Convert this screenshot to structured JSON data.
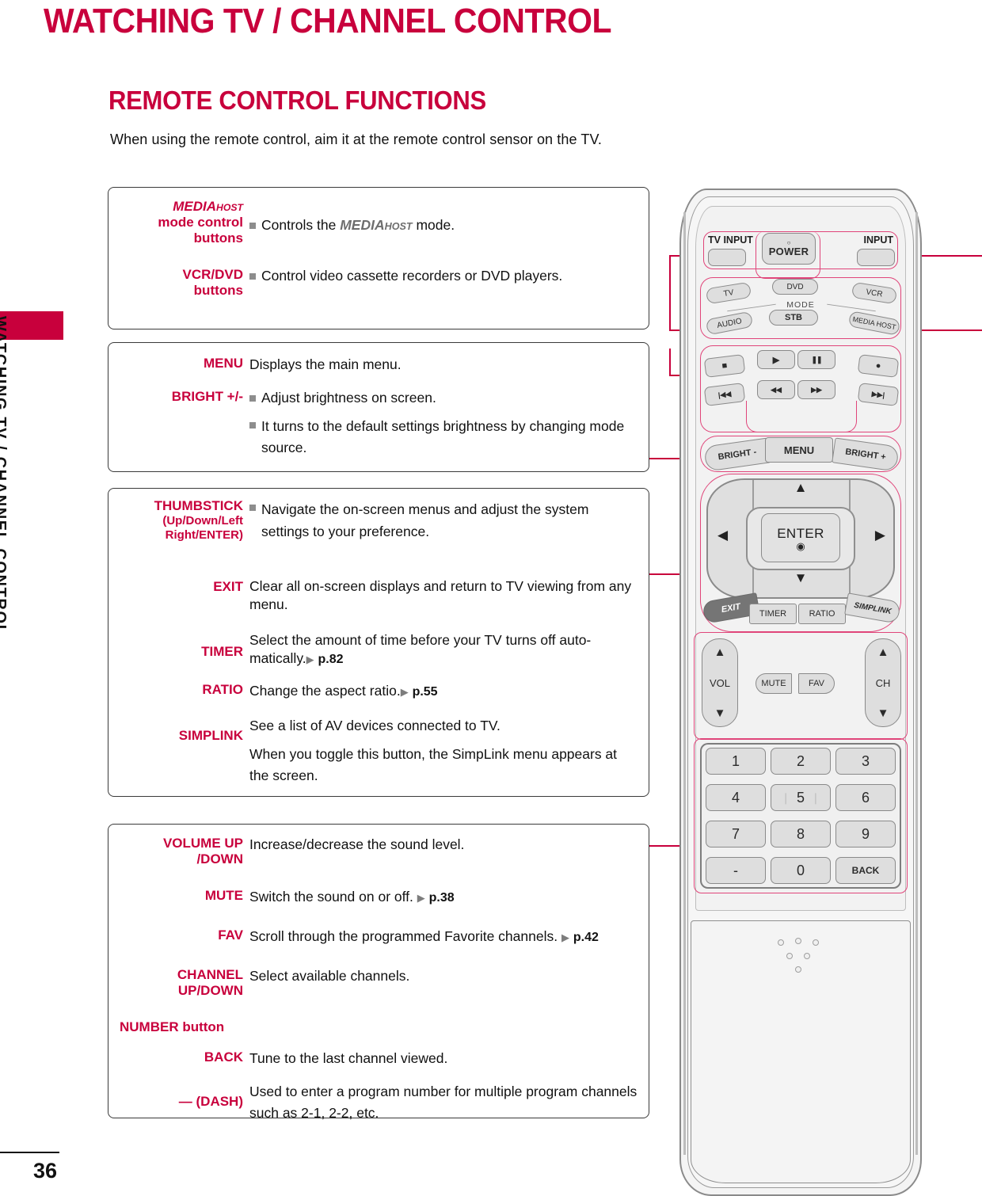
{
  "page": {
    "title": "WATCHING TV / CHANNEL CONTROL",
    "section_title": "REMOTE CONTROL FUNCTIONS",
    "intro": "When using the remote control, aim it at the remote control sensor on the TV.",
    "side_tab_text": "WATCHING TV / CHANNEL CONTROL",
    "page_number": "36",
    "accent_color": "#C8003C",
    "leader_color": "#C8003C"
  },
  "boxes": [
    {
      "id": "box1",
      "rows": [
        {
          "label_lines": [
            "MEDIAHOST",
            "mode control",
            "buttons"
          ],
          "label_logo": {
            "main": "MEDIA",
            "sub": "HOST"
          },
          "bullets": [
            {
              "pre": "Controls the ",
              "logo_main": "MEDIA",
              "logo_sub": "HOST",
              "post": " mode."
            }
          ]
        },
        {
          "label_lines": [
            "VCR/DVD",
            "buttons"
          ],
          "bullets": [
            {
              "pre": "Control video cassette recorders or DVD players."
            }
          ]
        }
      ]
    },
    {
      "id": "box2",
      "rows": [
        {
          "label_lines": [
            "MENU"
          ],
          "text": "Displays the main menu."
        },
        {
          "label_lines": [
            "BRIGHT +/-"
          ],
          "bullets": [
            {
              "pre": "Adjust brightness on screen."
            },
            {
              "pre": "It turns to the default settings brightness by changing mode source."
            }
          ]
        }
      ]
    },
    {
      "id": "box3",
      "rows": [
        {
          "label_lines": [
            "THUMBSTICK",
            "(Up/Down/Left",
            "Right/ENTER)"
          ],
          "bullets": [
            {
              "pre": "Navigate the on-screen menus and adjust the system settings to your preference."
            }
          ]
        },
        {
          "label_lines": [
            "EXIT"
          ],
          "text": "Clear all on-screen displays and return to TV viewing from any menu."
        },
        {
          "label_lines": [
            "TIMER"
          ],
          "text": "Select the amount of time before your TV turns off auto-matically.",
          "ref": "p.82"
        },
        {
          "label_lines": [
            "RATIO"
          ],
          "text": "Change the aspect ratio.",
          "ref": "p.55"
        },
        {
          "label_lines": [
            "SIMPLINK"
          ],
          "text": "See a list of AV devices connected to TV.",
          "text2": "When you toggle this button, the SimpLink menu appears at the screen."
        }
      ]
    },
    {
      "id": "box4",
      "rows": [
        {
          "label_lines": [
            "VOLUME UP",
            "/DOWN"
          ],
          "text": "Increase/decrease the sound level."
        },
        {
          "label_lines": [
            "MUTE"
          ],
          "text": "Switch the sound on or off.",
          "ref": "p.38"
        },
        {
          "label_lines": [
            "FAV"
          ],
          "text": "Scroll through the programmed Favorite channels.",
          "ref": "p.42"
        },
        {
          "label_lines": [
            "CHANNEL",
            "UP/DOWN"
          ],
          "text": "Select available channels."
        },
        {
          "label_lines": [
            "NUMBER button"
          ],
          "text": ""
        },
        {
          "label_lines": [
            "BACK"
          ],
          "text": "Tune to the last channel viewed."
        },
        {
          "label_lines": [
            "— (DASH)"
          ],
          "text": "Used to enter a program number for multiple program channels such as 2-1, 2-2, etc."
        }
      ]
    }
  ],
  "remote": {
    "top_row": {
      "tv_input": "TV INPUT",
      "power": "POWER",
      "input": "INPUT"
    },
    "mode_row": {
      "label": "MODE",
      "top": [
        "TV",
        "DVD",
        "VCR"
      ],
      "bottom": [
        "AUDIO",
        "STB",
        "MEDIA HOST"
      ]
    },
    "transport": {
      "row1": [
        "stop-icon",
        "play-icon",
        "pause-icon",
        "record-icon"
      ],
      "row2": [
        "skip-back-icon",
        "rewind-icon",
        "fast-forward-icon",
        "skip-forward-icon"
      ],
      "glyphs": {
        "stop": "■",
        "play": "▶",
        "pause": "❚❚",
        "record": "●",
        "skip_back": "|◀◀",
        "rewind": "◀◀",
        "forward": "▶▶",
        "skip_forward": "▶▶|"
      }
    },
    "bright_row": {
      "minus": "BRIGHT -",
      "menu": "MENU",
      "plus": "BRIGHT +"
    },
    "thumbstick": {
      "enter": "ENTER",
      "up": "▲",
      "down": "▼",
      "left": "◀",
      "right": "▶"
    },
    "function_row": [
      "EXIT",
      "TIMER",
      "RATIO",
      "SIMPLINK"
    ],
    "vol_ch": {
      "vol": "VOL",
      "ch": "CH",
      "mute": "MUTE",
      "fav": "FAV",
      "up": "▲",
      "down": "▼"
    },
    "keypad": [
      [
        "1",
        "2",
        "3"
      ],
      [
        "4",
        "5",
        "6"
      ],
      [
        "7",
        "8",
        "9"
      ],
      [
        "-",
        "0",
        "BACK"
      ]
    ]
  }
}
